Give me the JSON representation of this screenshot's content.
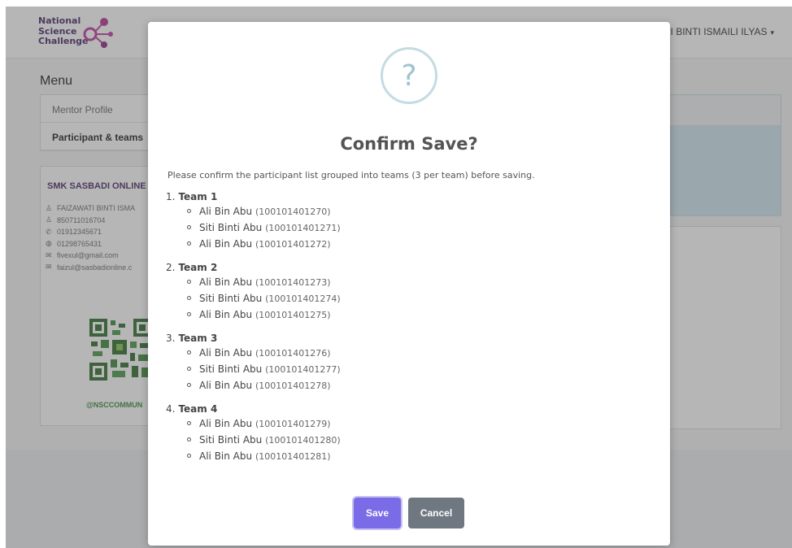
{
  "header": {
    "logo_text": "National\nScience\nChallenge",
    "user_name": "TI BINTI ISMAILI ILYAS",
    "caret": "▾"
  },
  "sidebar": {
    "menu_title": "Menu",
    "items": [
      {
        "label": "Mentor Profile"
      },
      {
        "label": "Participant & teams"
      }
    ]
  },
  "school": {
    "name": "SMK SASBADI ONLINE",
    "contacts": [
      {
        "icon": "user-icon",
        "glyph": "♙",
        "text": "FAIZAWATI BINTI ISMA"
      },
      {
        "icon": "user-icon",
        "glyph": "♙",
        "text": "850711016704"
      },
      {
        "icon": "phone-icon",
        "glyph": "✆",
        "text": "01912345671"
      },
      {
        "icon": "mobile-icon",
        "glyph": "◍",
        "text": "01298765431"
      },
      {
        "icon": "mail-icon",
        "glyph": "✉",
        "text": "fivexul@gmail.com"
      },
      {
        "icon": "mail-icon",
        "glyph": "✉",
        "text": "faizul@sasbadionline.c"
      }
    ],
    "qr_caption": "@NSCCOMMUN"
  },
  "modal": {
    "icon": "?",
    "title": "Confirm Save?",
    "description": "Please confirm the participant list grouped into teams (3 per team) before saving.",
    "teams": [
      {
        "num": "1.",
        "name": "Team 1",
        "members": [
          {
            "name": "Ali Bin Abu",
            "id": "(100101401270)"
          },
          {
            "name": "Siti Binti Abu",
            "id": "(100101401271)"
          },
          {
            "name": "Ali Bin Abu",
            "id": "(100101401272)"
          }
        ]
      },
      {
        "num": "2.",
        "name": "Team 2",
        "members": [
          {
            "name": "Ali Bin Abu",
            "id": "(100101401273)"
          },
          {
            "name": "Siti Binti Abu",
            "id": "(100101401274)"
          },
          {
            "name": "Ali Bin Abu",
            "id": "(100101401275)"
          }
        ]
      },
      {
        "num": "3.",
        "name": "Team 3",
        "members": [
          {
            "name": "Ali Bin Abu",
            "id": "(100101401276)"
          },
          {
            "name": "Siti Binti Abu",
            "id": "(100101401277)"
          },
          {
            "name": "Ali Bin Abu",
            "id": "(100101401278)"
          }
        ]
      },
      {
        "num": "4.",
        "name": "Team 4",
        "members": [
          {
            "name": "Ali Bin Abu",
            "id": "(100101401279)"
          },
          {
            "name": "Siti Binti Abu",
            "id": "(100101401280)"
          },
          {
            "name": "Ali Bin Abu",
            "id": "(100101401281)"
          }
        ]
      }
    ],
    "save_label": "Save",
    "cancel_label": "Cancel"
  },
  "colors": {
    "save": "#7a6ce6",
    "cancel": "#6f7880",
    "question_icon": "#9ec3d1",
    "brand": "#4b2a6b"
  }
}
